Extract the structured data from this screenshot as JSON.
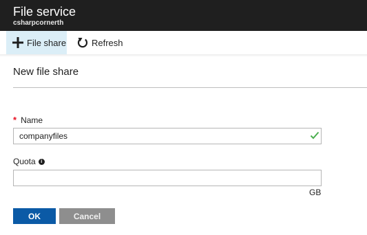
{
  "header": {
    "title": "File service",
    "subtitle": "csharpcornerth",
    "background": "#1f1f1f"
  },
  "toolbar": {
    "add_label": "File share",
    "add_icon": "plus-icon",
    "refresh_label": "Refresh",
    "refresh_icon": "refresh-icon"
  },
  "blade": {
    "title": "New file share"
  },
  "form": {
    "name": {
      "required_mark": "*",
      "label": "Name",
      "value": "companyfiles",
      "valid_icon": "checkmark-icon",
      "valid_color": "#4caf50"
    },
    "quota": {
      "label": "Quota",
      "info_icon": "info-icon",
      "info_glyph": "i",
      "value": "",
      "unit": "GB"
    }
  },
  "actions": {
    "ok_label": "OK",
    "cancel_label": "Cancel",
    "ok_color": "#0b5aa6",
    "cancel_color": "#8e8e8e"
  }
}
